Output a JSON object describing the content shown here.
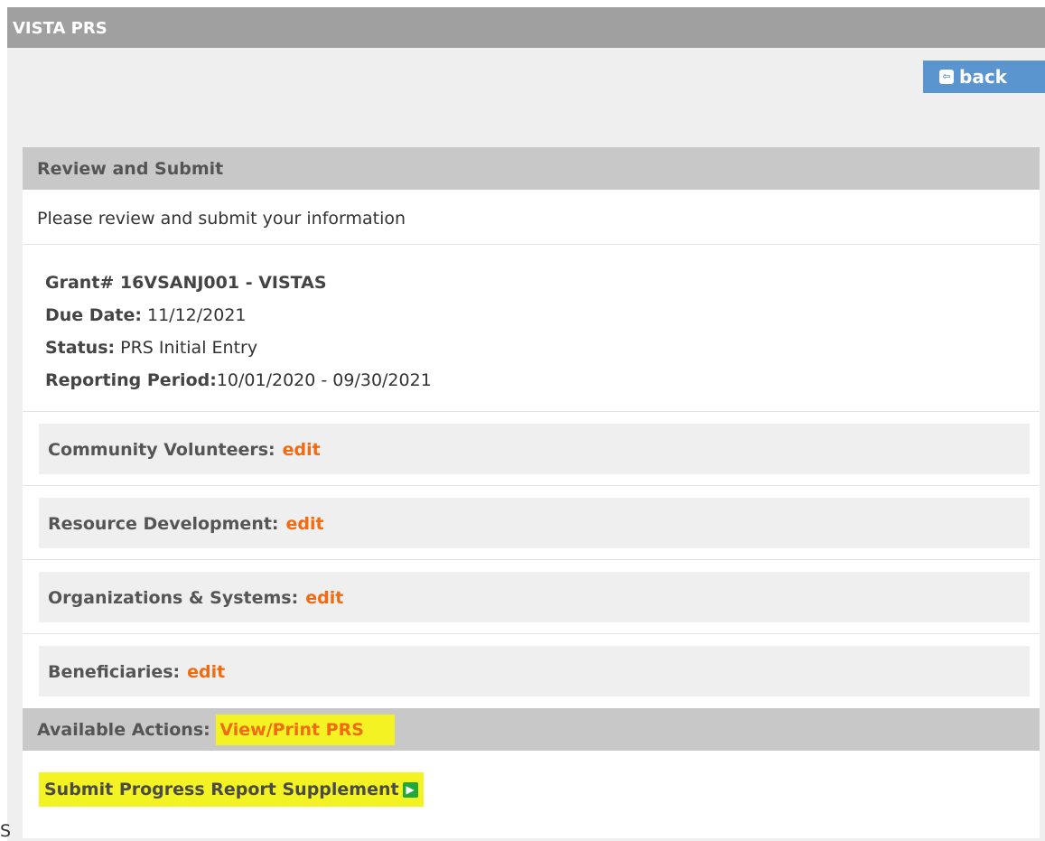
{
  "window": {
    "title": "VISTA PRS"
  },
  "toolbar": {
    "back_label": "back",
    "back_icon": "back-arrow-icon"
  },
  "review": {
    "header": "Review and Submit",
    "intro": "Please review and submit your information",
    "grant": "Grant# 16VSANJ001 - VISTAS",
    "due_date_label": "Due Date:",
    "due_date": " 11/12/2021",
    "status_label": "Status:",
    "status": " PRS Initial Entry",
    "period_label": "Reporting Period:",
    "period": "10/01/2020 - 09/30/2021"
  },
  "sections": [
    {
      "label": "Community Volunteers:",
      "action": "edit"
    },
    {
      "label": "Resource Development:",
      "action": "edit"
    },
    {
      "label": "Organizations & Systems:",
      "action": "edit"
    },
    {
      "label": "Beneficiaries:",
      "action": "edit"
    }
  ],
  "actions": {
    "label": "Available Actions:",
    "view_print": "View/Print PRS",
    "submit_label": "Submit Progress Report Supplement",
    "submit_icon": "arrow-right-icon"
  },
  "stray_text": "S",
  "colors": {
    "titlebar": "#a0a0a0",
    "back_button": "#5b95cf",
    "edit_link": "#f26b12",
    "highlight": "#f3f323",
    "go_icon": "#22a83a"
  }
}
